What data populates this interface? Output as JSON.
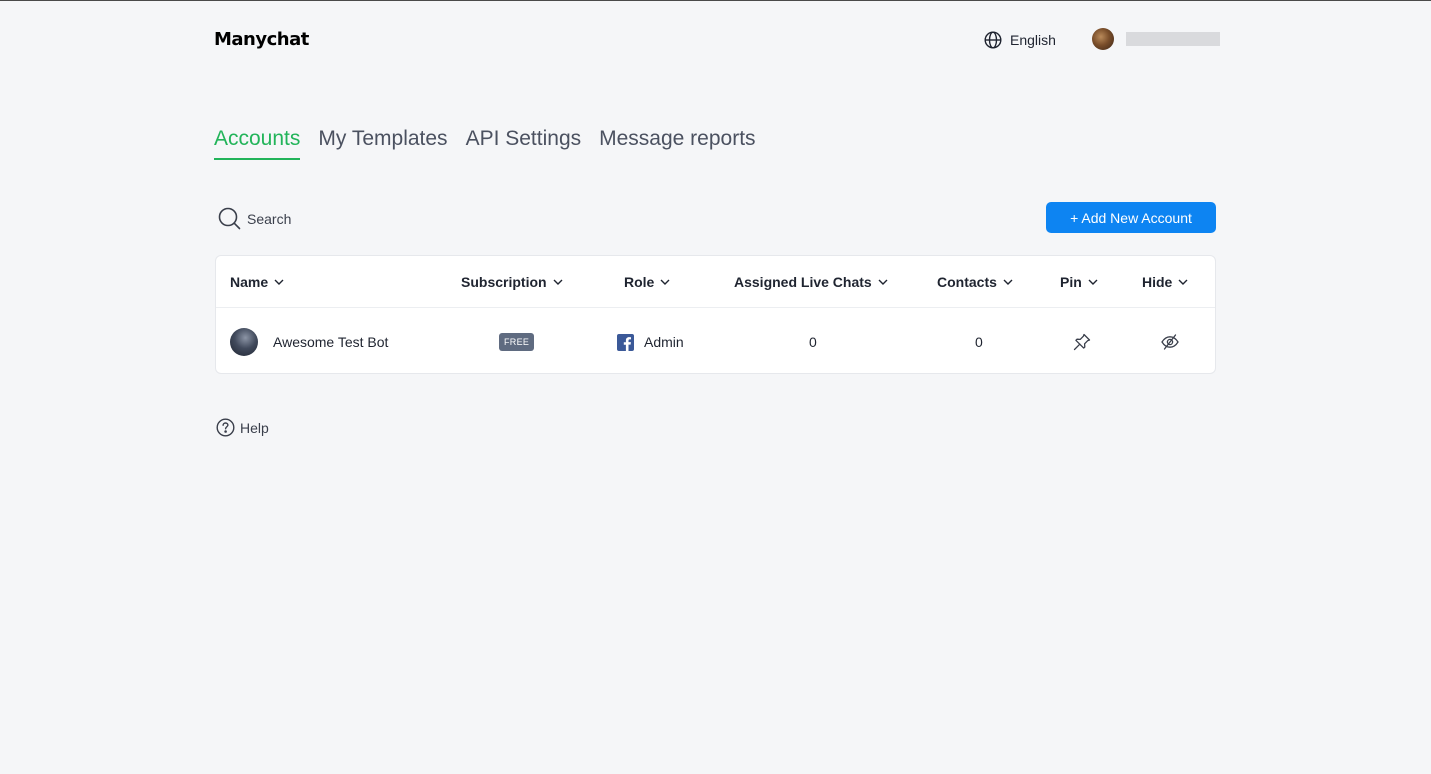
{
  "header": {
    "logo": "Manychat",
    "language": "English",
    "language_icon": "globe-icon",
    "user_avatar_icon": "avatar"
  },
  "tabs": [
    {
      "label": "Accounts",
      "active": true
    },
    {
      "label": "My Templates",
      "active": false
    },
    {
      "label": "API Settings",
      "active": false
    },
    {
      "label": "Message reports",
      "active": false
    }
  ],
  "search": {
    "label": "Search",
    "icon": "search-icon"
  },
  "add_button": {
    "label": "+ Add New Account"
  },
  "table": {
    "columns": [
      "Name",
      "Subscription",
      "Role",
      "Assigned Live Chats",
      "Contacts",
      "Pin",
      "Hide"
    ],
    "rows": [
      {
        "name": "Awesome Test Bot",
        "subscription": "FREE",
        "role": "Admin",
        "role_icon": "facebook-icon",
        "assigned_live_chats": "0",
        "contacts": "0",
        "pin_icon": "pin-icon",
        "hide_icon": "eye-off-icon"
      }
    ]
  },
  "help": {
    "label": "Help",
    "icon": "question-circle-icon"
  },
  "colors": {
    "accent_green": "#22b45a",
    "primary_blue": "#0d84f2",
    "background": "#f5f6f8",
    "badge": "#5f6b80",
    "facebook": "#3b5998"
  }
}
